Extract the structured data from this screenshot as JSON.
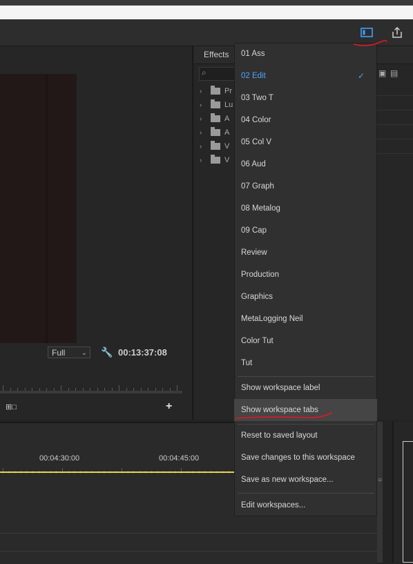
{
  "timecode": "00:13:37:08",
  "zoom_select": "Full",
  "effects_panel": {
    "title": "Effects",
    "tree": [
      {
        "label": "Pr"
      },
      {
        "label": "Lu"
      },
      {
        "label": "A"
      },
      {
        "label": "A"
      },
      {
        "label": "V"
      },
      {
        "label": "V"
      }
    ]
  },
  "timeline": {
    "time_labels": [
      "00:04:30:00",
      "00:04:45:00"
    ]
  },
  "workspace_menu": {
    "workspaces": [
      {
        "label": "01 Ass",
        "selected": false
      },
      {
        "label": "02 Edit",
        "selected": true
      },
      {
        "label": "03 Two T",
        "selected": false
      },
      {
        "label": "04 Color",
        "selected": false
      },
      {
        "label": "05 Col V",
        "selected": false
      },
      {
        "label": "06 Aud",
        "selected": false
      },
      {
        "label": "07 Graph",
        "selected": false
      },
      {
        "label": "08 Metalog",
        "selected": false
      },
      {
        "label": "09 Cap",
        "selected": false
      },
      {
        "label": "Review",
        "selected": false
      },
      {
        "label": "Production",
        "selected": false
      },
      {
        "label": "Graphics",
        "selected": false
      },
      {
        "label": "MetaLogging Neil",
        "selected": false
      },
      {
        "label": "Color Tut",
        "selected": false
      },
      {
        "label": "Tut",
        "selected": false
      }
    ],
    "show_label": "Show workspace label",
    "show_tabs": "Show workspace tabs",
    "reset": "Reset to saved layout",
    "save_changes": "Save changes to this workspace",
    "save_new": "Save as new workspace...",
    "edit": "Edit workspaces..."
  },
  "colors": {
    "accent": "#4fa3ff",
    "annotation": "#e0162b",
    "playhead": "#e8d44d"
  }
}
